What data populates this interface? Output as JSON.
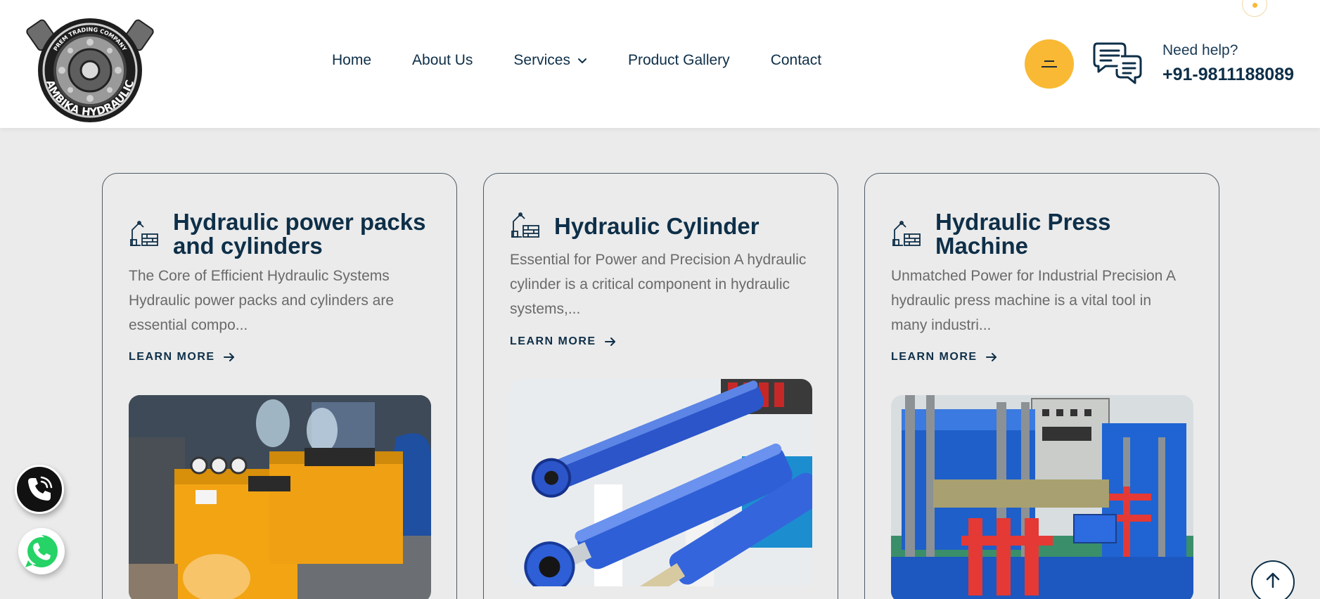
{
  "header": {
    "logo": {
      "top_text": "PREM TRADING COMPANY",
      "brand_text": "AMBIKA HYDRAULIC"
    },
    "nav": [
      {
        "label": "Home"
      },
      {
        "label": "About Us"
      },
      {
        "label": "Services",
        "has_dropdown": true
      },
      {
        "label": "Product Gallery"
      },
      {
        "label": "Contact"
      }
    ],
    "help_label": "Need help?",
    "help_phone": "+91-9811188089",
    "icons": {
      "menu": "menu-icon",
      "chat": "chat-bubbles-icon"
    }
  },
  "cards": [
    {
      "title_lines": [
        "Hydraulic power packs",
        "and cylinders"
      ],
      "desc_lines": [
        "The Core of Efficient Hydraulic Systems",
        "Hydraulic power packs and cylinders are",
        "essential compo..."
      ],
      "learn_more": "LEARN MORE",
      "image": "orange hydraulic power pack units"
    },
    {
      "title_lines": [
        "Hydraulic Cylinder"
      ],
      "desc_lines": [
        "Essential for Power and Precision A hydraulic",
        "cylinder is a critical component in hydraulic",
        "systems,..."
      ],
      "learn_more": "LEARN MORE",
      "image": "blue hydraulic cylinders"
    },
    {
      "title_lines": [
        "Hydraulic Press",
        "Machine"
      ],
      "desc_lines": [
        "Unmatched Power for Industrial Precision A",
        "hydraulic press machine is a vital tool in",
        "many industri..."
      ],
      "learn_more": "LEARN MORE",
      "image": "blue and red hydraulic press machines"
    }
  ],
  "floating": {
    "call": "phone-icon",
    "whatsapp": "whatsapp-icon",
    "scroll_top": "arrow-up-icon"
  },
  "colors": {
    "accent": "#f9b934",
    "navy": "#0e2f48",
    "background": "#ebebeb",
    "whatsapp": "#25d366"
  }
}
